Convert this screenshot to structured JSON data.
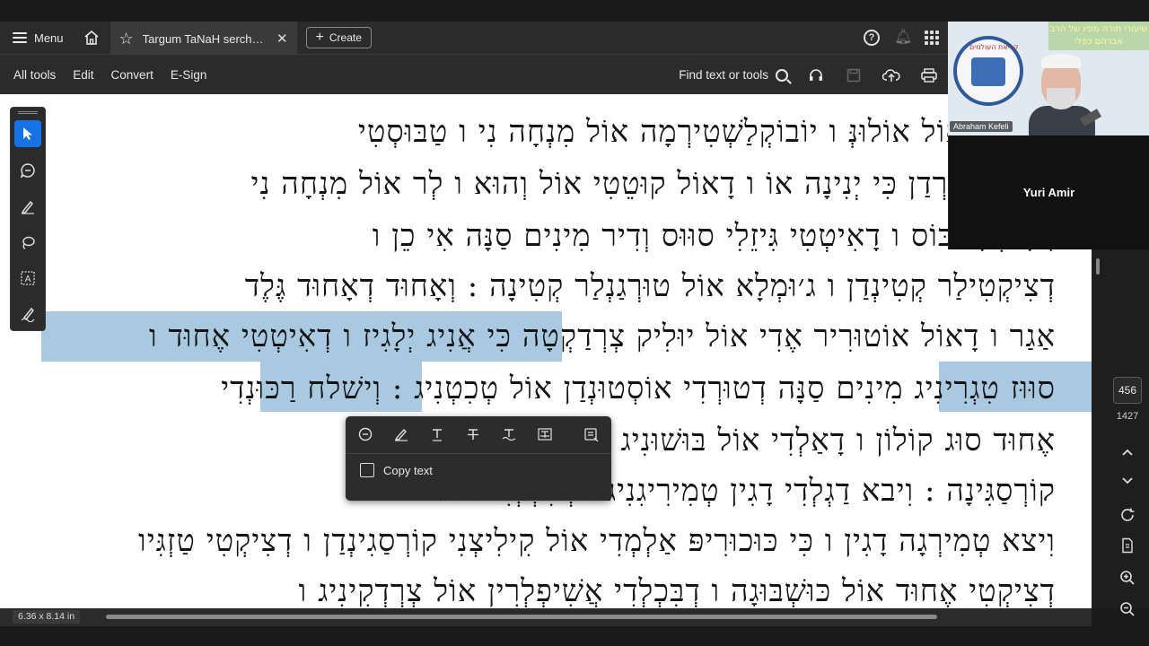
{
  "topbar": {
    "menu_label": "Menu",
    "tab_title": "Targum TaNaH serchab...",
    "create_label": "Create"
  },
  "toolbar": {
    "items": [
      "All tools",
      "Edit",
      "Convert",
      "E-Sign"
    ],
    "find_label": "Find text or tools"
  },
  "document": {
    "lines": [
      "דִּבְּרִידִי אוֹל אוֹלוּנְּ ו יוֹבוֹקְלַשְׁטִירְמָה אוֹל מִנְחָה נִי ו טַבּוּסְטִי",
      "אוֹל וּנְמַלַּרְדַן כִּי יְנִינָה אוֹ ו דָאוֹל קוּטֵטִי אוֹל וְהוּא ו לְר אוֹל מִנְחָה נִי",
      "דָאִיטְטִי כּוֹס ו דָאִיטְטִי גִּיזֵלִי סוּוּס וְדִיר מִינִים סַנָּה אִי כֵן ו",
      "דְצִיקְטִילַר קְטִינְדַן ו ג׳וּמְלָא אוֹל טוּרְגַנְלַר קְטִינָה : וְאָחוּד דְאָחוּד גֶּלֶד",
      "אַגַר ו דָאוֹל אוֹטוּרִיר אֶדִי אוֹל יוּלִיק צְרְדַקְטָה כִּי אֲנִיג יְלָגִיז ו דְאִיטְטִי אֶחוּד ו",
      "סוּוּז טִגְרִינִיג מִינִים סַנָּה דְטוּרְדִי אוֹסְטוּנְדַן אוֹל טְכִטְנִיג : וְישׁלח רַכּוּנְדִי",
      "אֶחוּד סוּג קוֹלוֹן ו דָאַלְדִי אוֹל בּוּשׁוּנִיג ו דְסַנְצְטִי אֲנִי",
      "קוֹרְסַגִּינָה : וִיבא דַגְלְדִי דָגִין טְמִירִיגִנִיג ו דְבִּכְלְדִי אוֹל",
      "וִיצא טְמִירְגָה דָגִין ו כִּי כּוּכוּרִיפּ אַלְמְדִי אוֹל קִילִיצְנִי קוֹרְסַגִינְדַן ו דְצִיקְטִי טַזְגִּיו",
      "דְצִיקְטִי אֶחוּד אוֹל כּוּשְׁבּוּגָה ו דְבִּכְלְדִי אֲשִׁיפְלְרִין אוֹל צְרְדְקִינִיג ו"
    ]
  },
  "popup": {
    "copy_label": "Copy text"
  },
  "navigation": {
    "current_page": "456",
    "total_pages": "1427"
  },
  "status": {
    "page_size": "6.36 x 8.14 in"
  },
  "video": {
    "banner_text": "שיעורי תורה מפיו של הרב אברהם כפלי",
    "logo_text": "קריאת העולמים",
    "speaker_badge": "Abraham Kefeli",
    "participant_name": "Yuri Amir"
  },
  "colors": {
    "highlight": "#9fc3dd",
    "active_tool": "#1473e6"
  }
}
